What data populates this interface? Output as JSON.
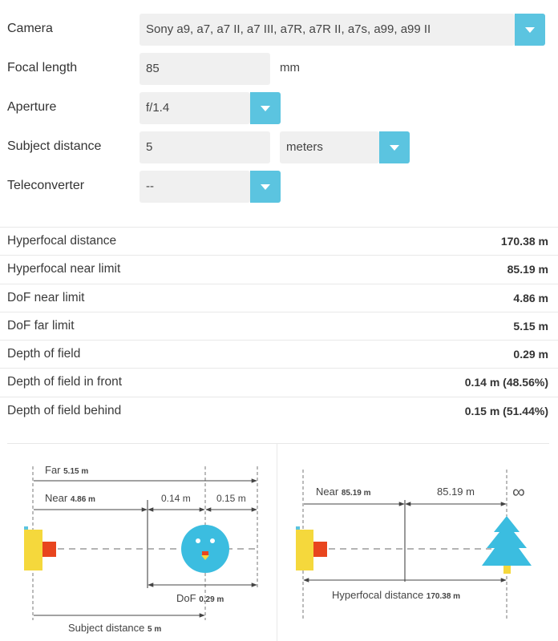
{
  "form": {
    "camera": {
      "label": "Camera",
      "value": "Sony a9, a7, a7 II, a7 III, a7R, a7R II, a7s, a99, a99 II"
    },
    "focal_length": {
      "label": "Focal length",
      "value": "85",
      "unit": "mm"
    },
    "aperture": {
      "label": "Aperture",
      "value": "f/1.4"
    },
    "subject_distance": {
      "label": "Subject distance",
      "value": "5",
      "unit": "meters"
    },
    "teleconverter": {
      "label": "Teleconverter",
      "value": "--"
    }
  },
  "results": [
    {
      "label": "Hyperfocal distance",
      "value": "170.38 m"
    },
    {
      "label": "Hyperfocal near limit",
      "value": "85.19 m"
    },
    {
      "label": "DoF near limit",
      "value": "4.86 m"
    },
    {
      "label": "DoF far limit",
      "value": "5.15 m"
    },
    {
      "label": "Depth of field",
      "value": "0.29 m"
    },
    {
      "label": "Depth of field in front",
      "value": "0.14 m (48.56%)"
    },
    {
      "label": "Depth of field behind",
      "value": "0.15 m (51.44%)"
    }
  ],
  "dof_diagram": {
    "far_label": "Far",
    "far_value": "5.15 m",
    "near_label": "Near",
    "near_value": "4.86 m",
    "front_value": "0.14 m",
    "behind_value": "0.15 m",
    "dof_label": "DoF",
    "dof_value": "0.29 m",
    "subject_label": "Subject distance",
    "subject_value": "5 m"
  },
  "hyperfocal_diagram": {
    "near_label": "Near",
    "near_value": "85.19 m",
    "half_value": "85.19 m",
    "infinity_symbol": "∞",
    "hyperfocal_label": "Hyperfocal distance",
    "hyperfocal_value": "170.38 m"
  },
  "colors": {
    "accent": "#5bc4e0",
    "camera_body": "#f5d83c",
    "camera_lens": "#e8451e",
    "subject": "#3bbde0",
    "tree": "#3bbde0"
  }
}
